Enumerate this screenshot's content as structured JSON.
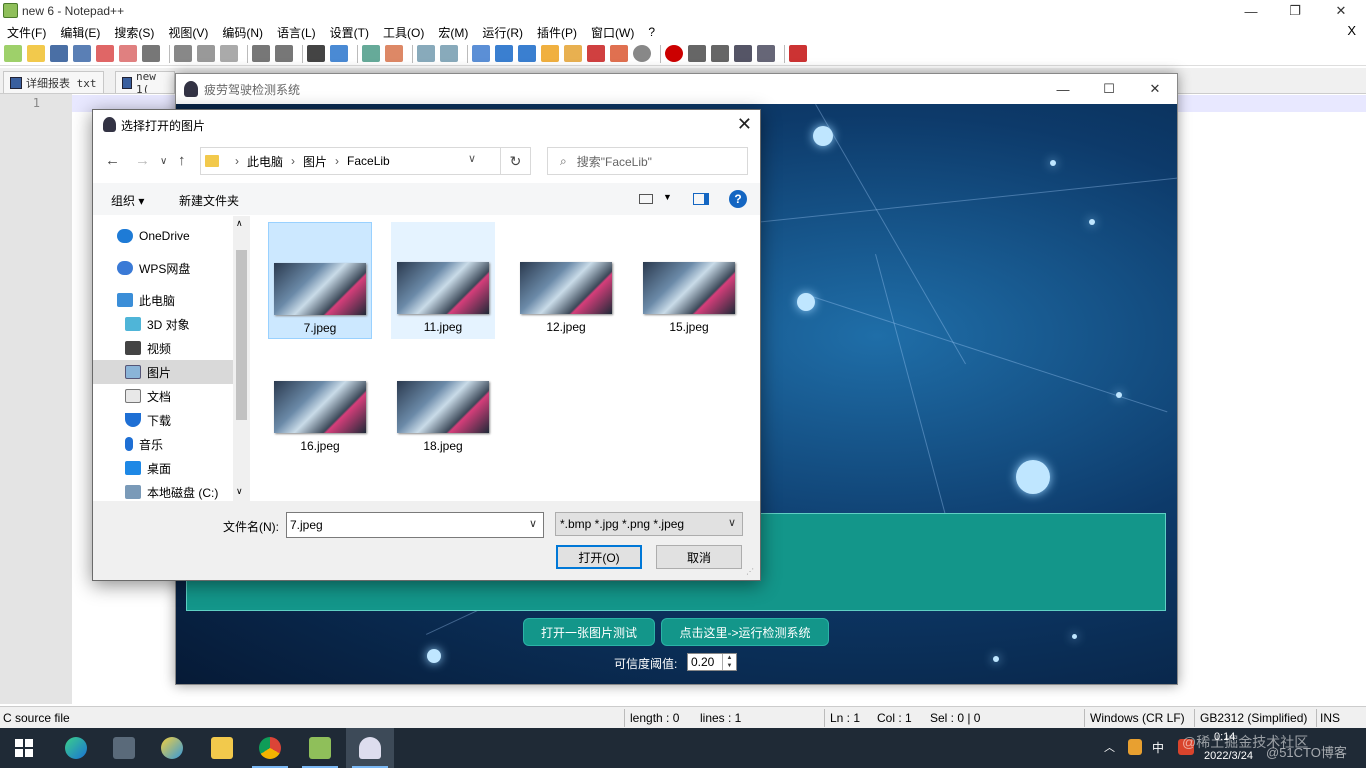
{
  "npp": {
    "title": "new 6 - Notepad++",
    "menu": [
      "文件(F)",
      "编辑(E)",
      "搜索(S)",
      "视图(V)",
      "编码(N)",
      "语言(L)",
      "设置(T)",
      "工具(O)",
      "宏(M)",
      "运行(R)",
      "插件(P)",
      "窗口(W)",
      "?"
    ],
    "menu_close": "X",
    "tabs": [
      "详细报表 txt",
      "new 1("
    ],
    "line_number": "1",
    "status": {
      "file_type": "C source file",
      "length": "length : 0",
      "lines": "lines : 1",
      "ln": "Ln : 1",
      "col": "Col : 1",
      "sel": "Sel : 0 | 0",
      "eol": "Windows (CR LF)",
      "encoding": "GB2312 (Simplified)",
      "mode": "INS"
    }
  },
  "app": {
    "title": "疲劳驾驶检测系统",
    "btn_open_image": "打开一张图片测试",
    "btn_run": "点击这里->运行检测系统",
    "threshold_label": "可信度阈值:",
    "threshold_value": "0.20",
    "colors": {
      "panel": "#13968a"
    }
  },
  "dialog": {
    "title": "选择打开的图片",
    "path": [
      "此电脑",
      "图片",
      "FaceLib"
    ],
    "search_placeholder": "搜索\"FaceLib\"",
    "organize": "组织 ▾",
    "new_folder": "新建文件夹",
    "help": "?",
    "tree": [
      {
        "label": "OneDrive",
        "icon": "cloud-icon"
      },
      {
        "label": "WPS网盘",
        "icon": "cloud-icon"
      },
      {
        "label": "此电脑",
        "icon": "computer-icon"
      },
      {
        "label": "3D 对象",
        "icon": "cube-icon"
      },
      {
        "label": "视频",
        "icon": "video-icon"
      },
      {
        "label": "图片",
        "icon": "picture-icon",
        "selected": true
      },
      {
        "label": "文档",
        "icon": "document-icon"
      },
      {
        "label": "下载",
        "icon": "download-icon"
      },
      {
        "label": "音乐",
        "icon": "music-icon"
      },
      {
        "label": "桌面",
        "icon": "desktop-icon"
      },
      {
        "label": "本地磁盘 (C:)",
        "icon": "disk-icon"
      }
    ],
    "files": [
      {
        "name": "7.jpeg",
        "state": "selected"
      },
      {
        "name": "11.jpeg",
        "state": "hover"
      },
      {
        "name": "12.jpeg",
        "state": "normal"
      },
      {
        "name": "15.jpeg",
        "state": "normal"
      },
      {
        "name": "16.jpeg",
        "state": "normal"
      },
      {
        "name": "18.jpeg",
        "state": "normal"
      }
    ],
    "filename_label": "文件名(N):",
    "filename_value": "7.jpeg",
    "filetype_value": "*.bmp *.jpg *.png *.jpeg",
    "open_label": "打开(O)",
    "cancel_label": "取消"
  },
  "tray": {
    "time": "0:14",
    "date": "2022/3/24",
    "ime": "中",
    "watermark": "@稀土掘金技术社区",
    "watermark2": "@51CTO博客"
  }
}
